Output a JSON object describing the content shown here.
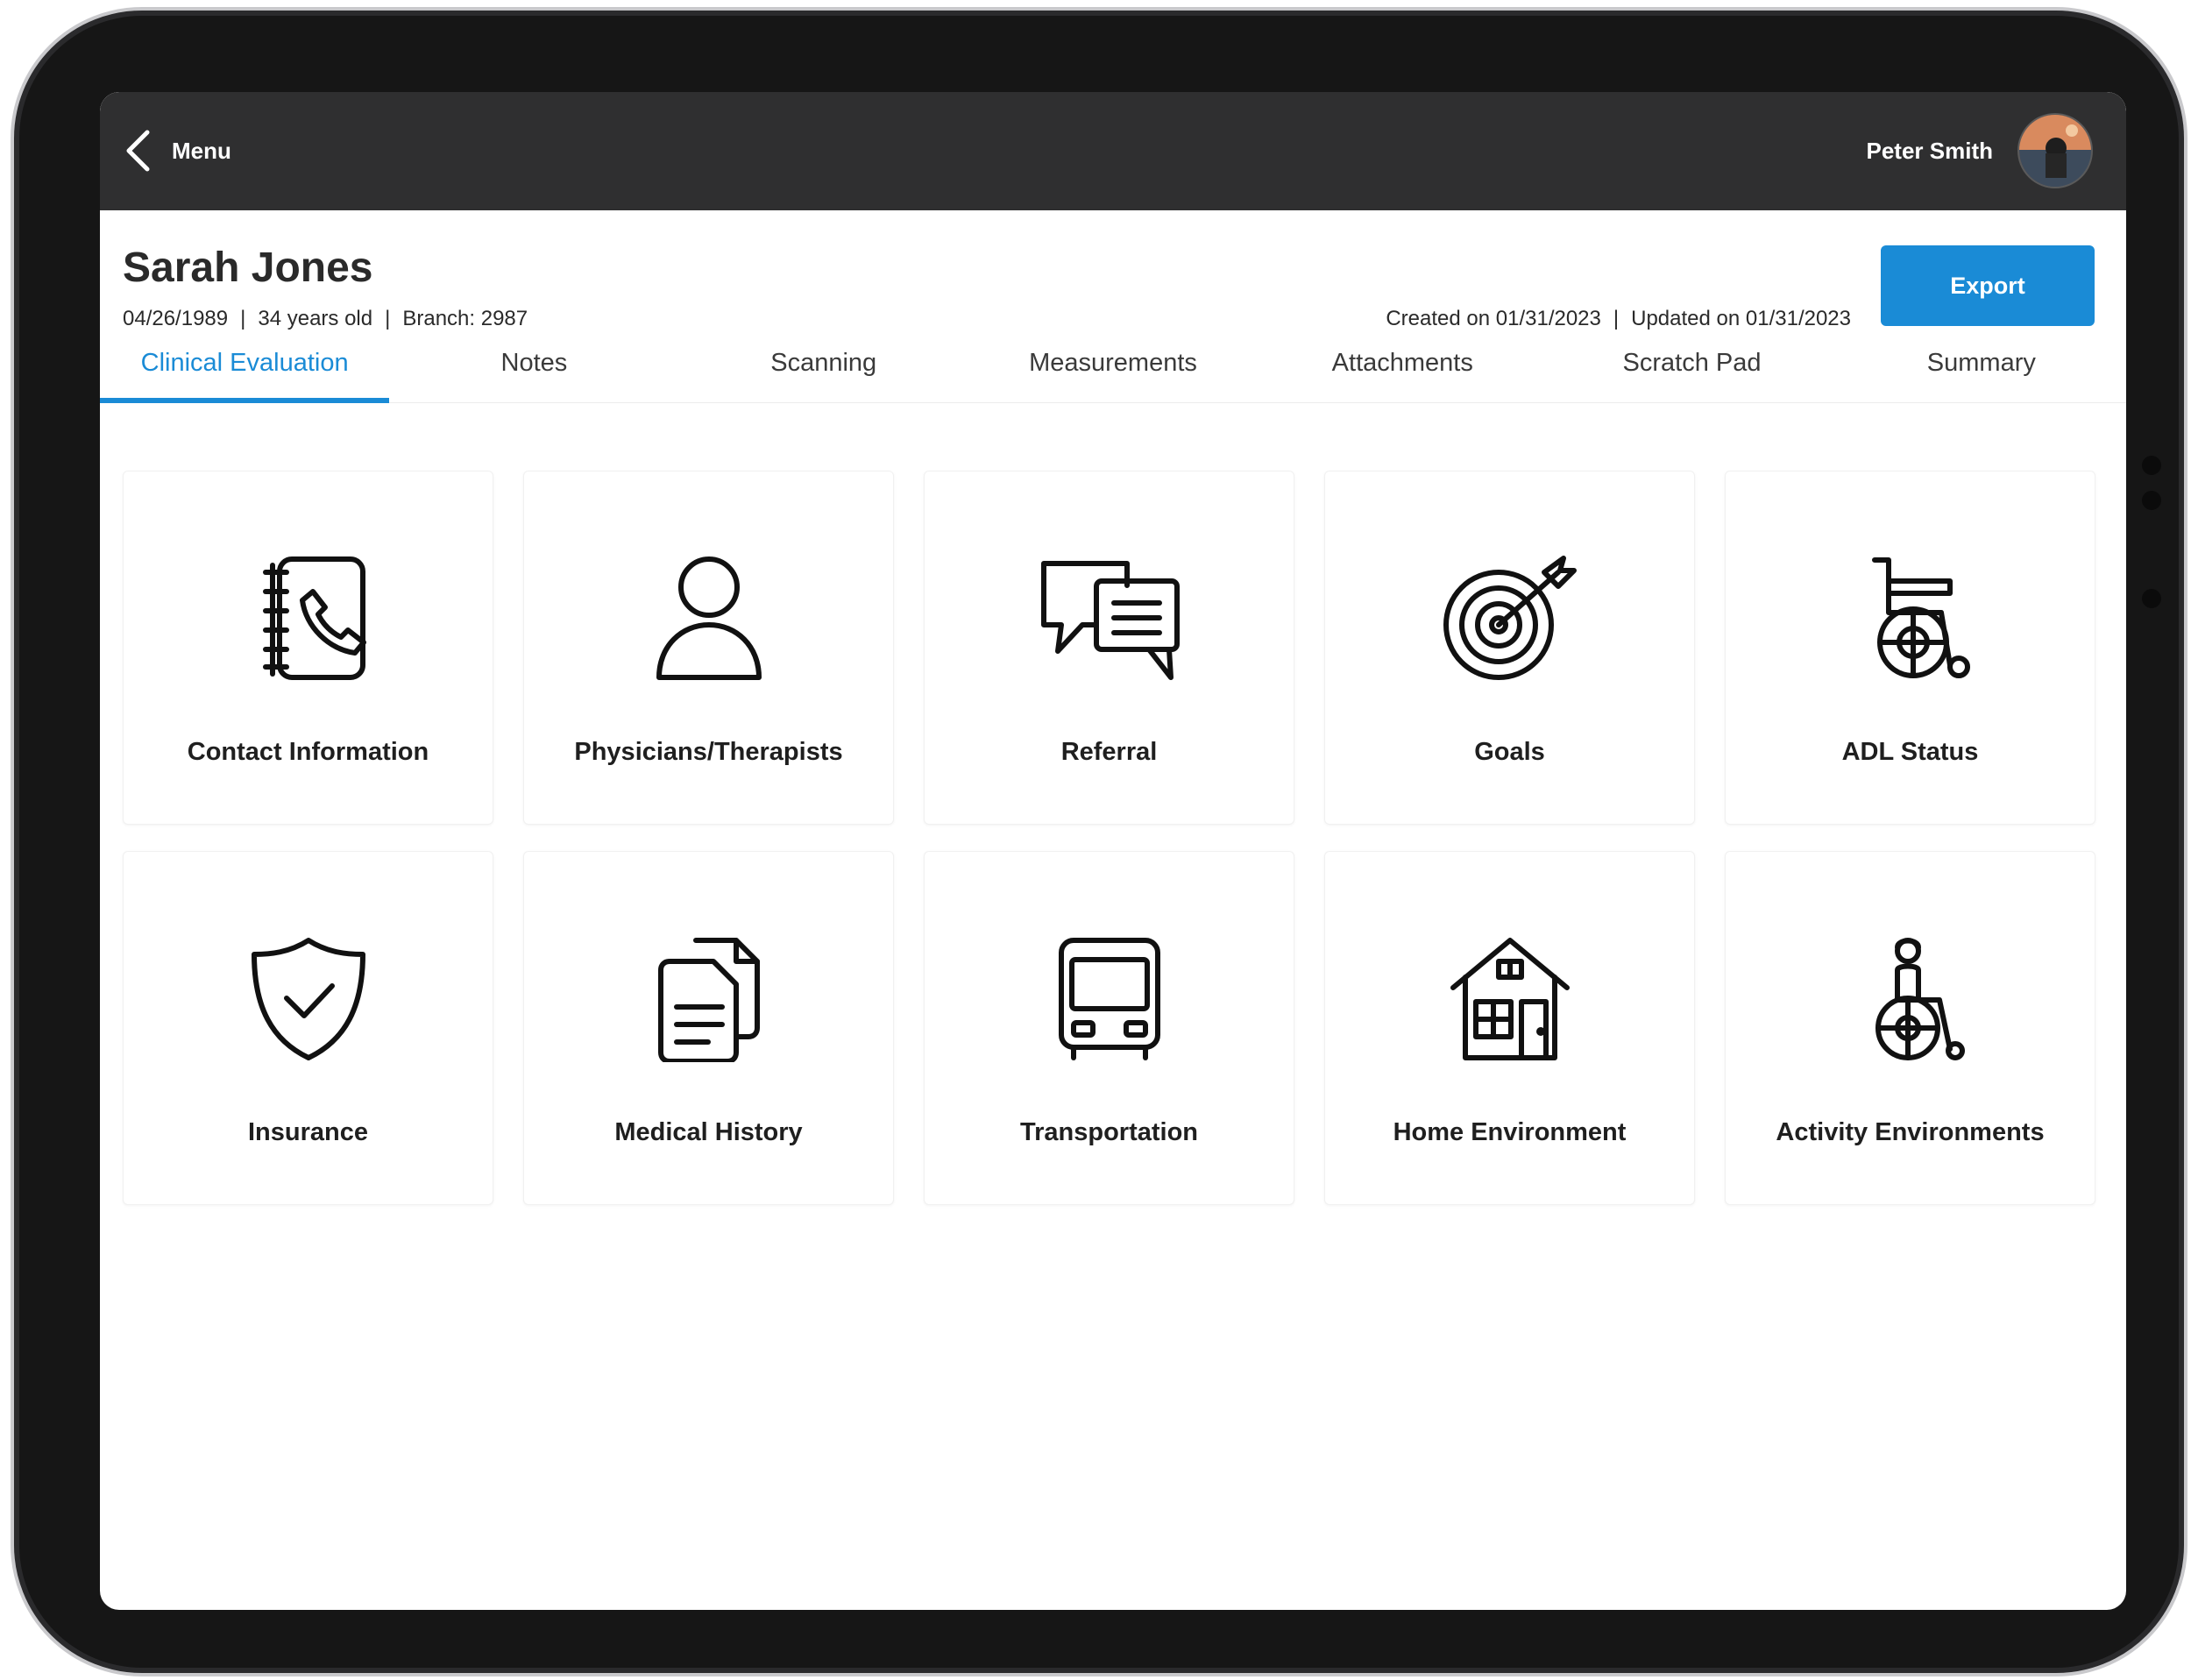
{
  "topbar": {
    "back_label": "Menu",
    "user_name": "Peter Smith"
  },
  "patient": {
    "name": "Sarah Jones",
    "dob": "04/26/1989",
    "age": "34 years old",
    "branch": "Branch: 2987",
    "created": "Created on 01/31/2023",
    "updated": "Updated on 01/31/2023",
    "separator": "|"
  },
  "actions": {
    "export_label": "Export"
  },
  "tabs": [
    {
      "label": "Clinical Evaluation",
      "active": true
    },
    {
      "label": "Notes"
    },
    {
      "label": "Scanning"
    },
    {
      "label": "Measurements"
    },
    {
      "label": "Attachments"
    },
    {
      "label": "Scratch Pad"
    },
    {
      "label": "Summary"
    }
  ],
  "cards": [
    {
      "label": "Contact Information",
      "icon": "contact-book-icon"
    },
    {
      "label": "Physicians/Therapists",
      "icon": "person-icon"
    },
    {
      "label": "Referral",
      "icon": "chat-bubbles-icon"
    },
    {
      "label": "Goals",
      "icon": "target-icon"
    },
    {
      "label": "ADL Status",
      "icon": "wheelchair-icon"
    },
    {
      "label": "Insurance",
      "icon": "shield-check-icon"
    },
    {
      "label": "Medical History",
      "icon": "documents-icon"
    },
    {
      "label": "Transportation",
      "icon": "bus-icon"
    },
    {
      "label": "Home Environment",
      "icon": "house-icon"
    },
    {
      "label": "Activity Environments",
      "icon": "person-wheelchair-icon"
    }
  ],
  "colors": {
    "accent": "#1a8bd6",
    "topbar": "#2f2f30",
    "bezel": "#161616"
  }
}
